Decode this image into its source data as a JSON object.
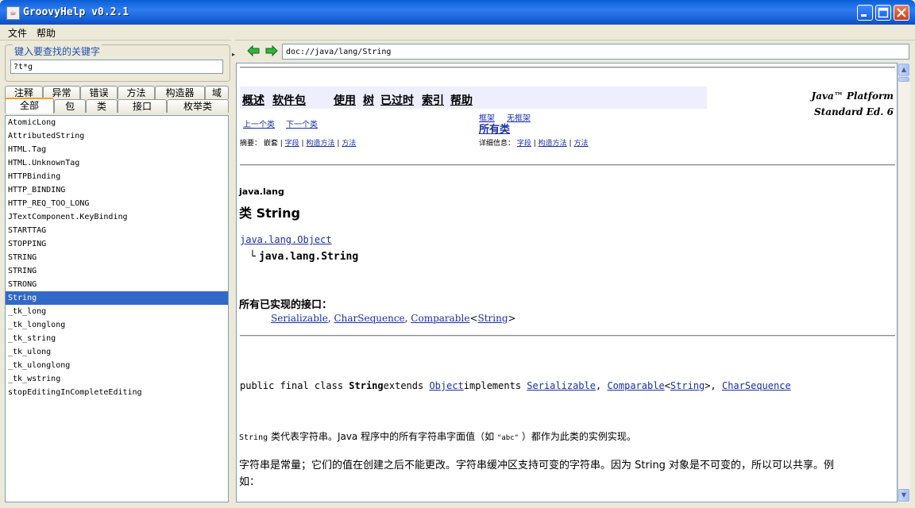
{
  "window": {
    "title": "GroovyHelp v0.2.1",
    "app_icon": "java-cup-icon",
    "buttons": [
      "minimize",
      "maximize",
      "close"
    ]
  },
  "menu": [
    "文件",
    "帮助"
  ],
  "search": {
    "legend": "键入要查找的关键字",
    "value": "?t*g"
  },
  "tabs_row1": [
    "注释",
    "异常",
    "错误",
    "方法",
    "构造器",
    "域"
  ],
  "tabs_row2": [
    "全部",
    "包",
    "类",
    "接口",
    "枚举类"
  ],
  "selected_tab": "全部",
  "results": [
    "AtomicLong",
    "AttributedString",
    "HTML.Tag",
    "HTML.UnknownTag",
    "HTTPBinding",
    "HTTP_BINDING",
    "HTTP_REQ_TOO_LONG",
    "JTextComponent.KeyBinding",
    "STARTTAG",
    "STOPPING",
    "STRING",
    "STRING",
    "STRONG",
    "String",
    "_tk_long",
    "_tk_longlong",
    "_tk_string",
    "_tk_ulong",
    "_tk_ulonglong",
    "_tk_wstring",
    "stopEditingInCompleteEditing"
  ],
  "selected_result": "String",
  "nav": {
    "back_icon": "back-arrow-icon",
    "forward_icon": "forward-arrow-icon",
    "url": "doc://java/lang/String"
  },
  "doc": {
    "nav_links": [
      "概述",
      "软件包",
      "使用",
      "树",
      "已过时",
      "索引",
      "帮助"
    ],
    "platform_line1": "Java™ Platform",
    "platform_line2": "Standard Ed. 6",
    "prev_class": "上一个类",
    "next_class": "下一个类",
    "frames": "框架",
    "no_frames": "无框架",
    "all_classes": "所有类",
    "summary_label": "摘要：",
    "summary_nested": "嵌套",
    "summary_field": "字段",
    "summary_constr": "构造方法",
    "summary_method": "方法",
    "detail_label": "详细信息：",
    "detail_field": "字段",
    "detail_constr": "构造方法",
    "detail_method": "方法",
    "package": "java.lang",
    "class_heading": "类 String",
    "super_class": "java.lang.Object",
    "tree_child": "java.lang.String",
    "interfaces_heading": "所有已实现的接口：",
    "interface_1": "Serializable",
    "interface_2": "CharSequence",
    "interface_3": "Comparable",
    "interface_3_arg": "String",
    "decl_prefix": "public final class ",
    "decl_name": "String",
    "decl_extends": "extends ",
    "decl_super": "Object",
    "decl_implements": "implements ",
    "decl_if1": "Serializable",
    "decl_if2": "Comparable",
    "decl_if2_arg": "String",
    "decl_if3": "CharSequence",
    "para1_code": "String",
    "para1_text1": " 类代表字符串。Java 程序中的所有字符串字面值（如 ",
    "para1_code2": "\"abc\"",
    "para1_text2": " ）都作为此类的实例实现。",
    "para2_line1": "字符串是常量；它们的值在创建之后不能更改。字符串缓冲区支持可变的字符串。因为 String 对象是不可变的，所以可以共享。例",
    "para2_line2": "如："
  }
}
